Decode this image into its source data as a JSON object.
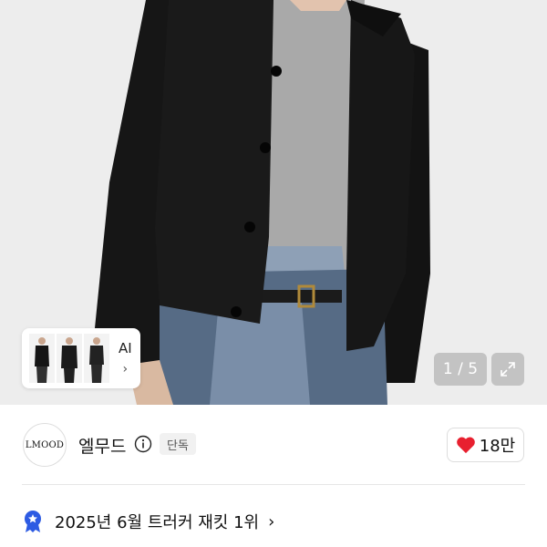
{
  "product": {
    "ai_label": "AI",
    "ai_chevron": "›",
    "pager": "1 / 5",
    "expand_icon": "expand-arrows-icon"
  },
  "seller": {
    "avatar_text": "LMOOD",
    "name": "엘무드",
    "info_icon": "info-circle-icon",
    "badge": "단독"
  },
  "like": {
    "icon": "heart-icon",
    "count": "18만",
    "color": "#e8202f"
  },
  "ranking": {
    "icon": "ribbon-star-icon",
    "text": "2025년 6월 트러커 재킷 1위",
    "chevron": "›",
    "color": "#2d5be3"
  }
}
